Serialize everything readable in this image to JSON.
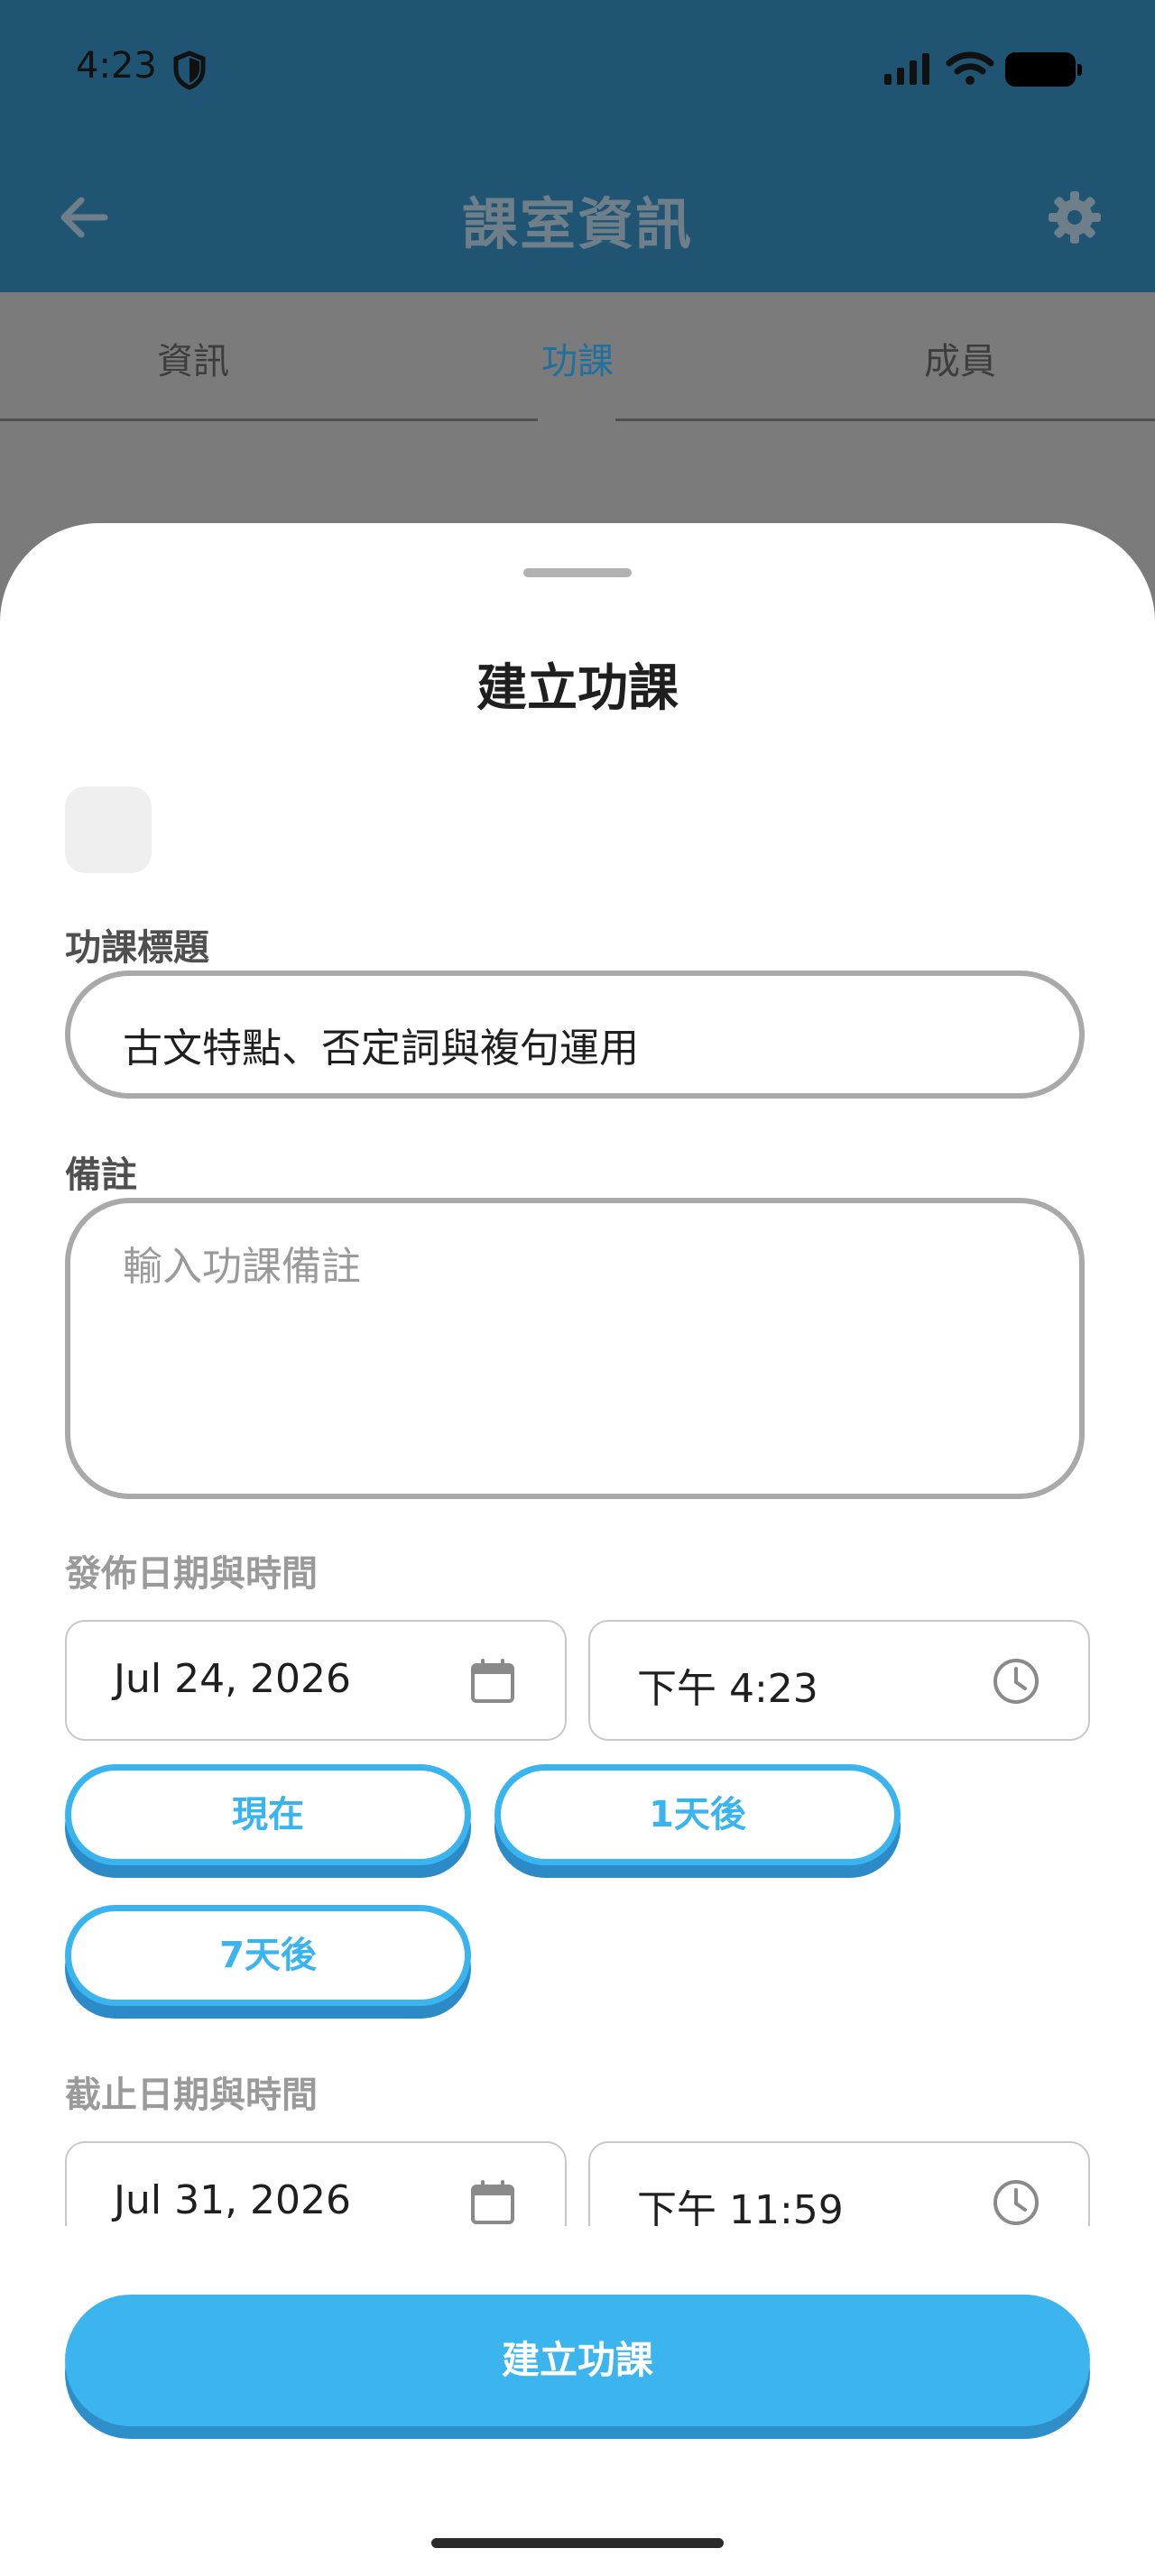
{
  "status_bar": {
    "time": "4:23"
  },
  "app_bar": {
    "title": "課室資訊"
  },
  "tabs": [
    {
      "label": "資訊",
      "active": false
    },
    {
      "label": "功課",
      "active": true
    },
    {
      "label": "成員",
      "active": false
    }
  ],
  "sheet": {
    "title": "建立功課",
    "homework_title_label": "功課標題",
    "homework_title_value": "古文特點、否定詞與複句運用",
    "notes_label": "備註",
    "notes_placeholder": "輸入功課備註",
    "publish_label": "發佈日期與時間",
    "publish_date": "Jul 24, 2026",
    "publish_time": "下午 4:23",
    "quick_buttons": [
      "現在",
      "1天後",
      "7天後"
    ],
    "due_label": "截止日期與時間",
    "due_date": "Jul 31, 2026",
    "due_time": "下午 11:59",
    "submit_label": "建立功課"
  },
  "colors": {
    "header_bg": "#1f5472",
    "accent": "#3cb4ee",
    "active_tab": "#1f6f9f"
  },
  "icons": [
    "shield-icon",
    "signal-icon",
    "wifi-icon",
    "battery-icon",
    "back-arrow-icon",
    "gear-icon",
    "calendar-icon",
    "clock-icon"
  ]
}
